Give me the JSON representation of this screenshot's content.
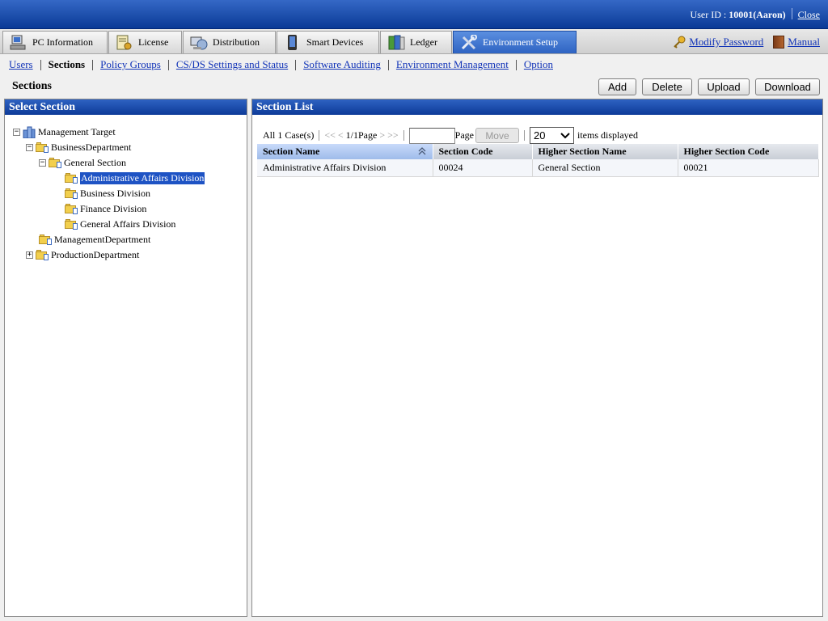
{
  "header": {
    "user_label": "User ID : ",
    "user_id": "10001(Aaron)",
    "close_label": "Close"
  },
  "tabs": [
    {
      "label": "PC Information",
      "icon": "pc-icon",
      "active": false
    },
    {
      "label": "License",
      "icon": "license-icon",
      "active": false
    },
    {
      "label": "Distribution",
      "icon": "distribution-icon",
      "active": false
    },
    {
      "label": "Smart Devices",
      "icon": "smartphone-icon",
      "active": false
    },
    {
      "label": "Ledger",
      "icon": "ledger-icon",
      "active": false
    },
    {
      "label": "Environment Setup",
      "icon": "tools-icon",
      "active": true
    }
  ],
  "top_links": {
    "modify_password": "Modify Password",
    "manual": "Manual"
  },
  "subnav": [
    {
      "label": "Users",
      "current": false
    },
    {
      "label": "Sections",
      "current": true
    },
    {
      "label": "Policy Groups",
      "current": false
    },
    {
      "label": "CS/DS Settings and Status",
      "current": false
    },
    {
      "label": "Software Auditing",
      "current": false
    },
    {
      "label": "Environment Management",
      "current": false
    },
    {
      "label": "Option",
      "current": false
    }
  ],
  "page": {
    "title": "Sections",
    "actions": {
      "add": "Add",
      "delete": "Delete",
      "upload": "Upload",
      "download": "Download"
    }
  },
  "left_panel": {
    "title": "Select Section",
    "tree": [
      {
        "label": "Management Target",
        "toggle": "−",
        "icon": "building-icon"
      },
      {
        "label": "BusinessDepartment",
        "toggle": "−",
        "icon": "folder-icon"
      },
      {
        "label": "General Section",
        "toggle": "−",
        "icon": "folder-icon"
      },
      {
        "label": "Administrative Affairs Division",
        "toggle": "",
        "icon": "folder-icon",
        "selected": true
      },
      {
        "label": "Business Division",
        "toggle": "",
        "icon": "folder-icon"
      },
      {
        "label": "Finance Division",
        "toggle": "",
        "icon": "folder-icon"
      },
      {
        "label": "General Affairs Division",
        "toggle": "",
        "icon": "folder-icon"
      },
      {
        "label": "ManagementDepartment",
        "toggle": "",
        "icon": "folder-icon"
      },
      {
        "label": "ProductionDepartment",
        "toggle": "+",
        "icon": "folder-icon"
      }
    ]
  },
  "right_panel": {
    "title": "Section List",
    "pager": {
      "count_text": "All 1 Case(s)",
      "first": "<<",
      "prev": "<",
      "page_text": "1/1Page",
      "next": ">",
      "last": ">>",
      "page_input_value": "",
      "page_label": "Page",
      "move_label": "Move",
      "per_page": "20",
      "items_label": "items displayed"
    },
    "columns": [
      "Section Name",
      "Section Code",
      "Higher Section Name",
      "Higher Section Code"
    ],
    "rows": [
      [
        "Administrative Affairs Division",
        "00024",
        "General Section",
        "00021"
      ]
    ]
  },
  "colors": {
    "header_blue": "#0a3a96",
    "link_blue": "#1234b8",
    "selection_blue": "#1e53c4"
  }
}
